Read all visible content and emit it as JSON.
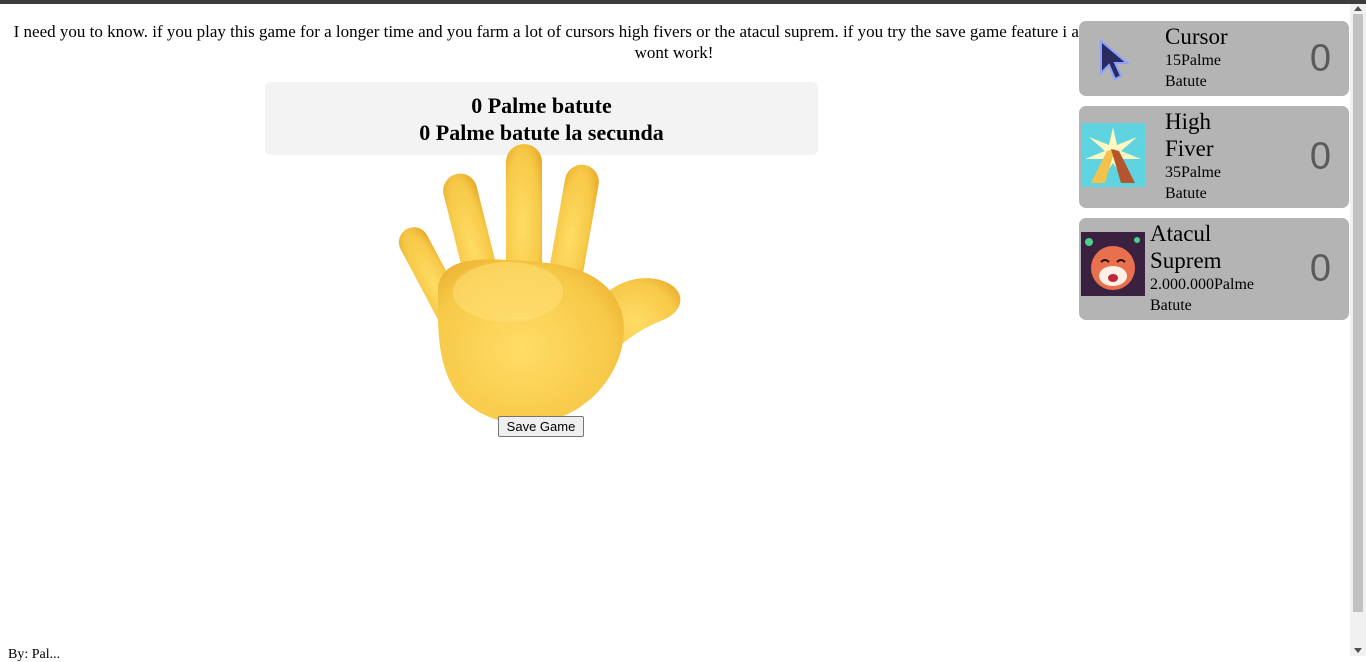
{
  "notice": {
    "text": "I need you to know. if you play this game for a longer time and you farm a lot of cursors high fivers or the atacul suprem. if you try the save game feature i am not responsable for this. the cookie wont work!"
  },
  "score": {
    "total_label": "0 Palme batute",
    "per_second_label": "0 Palme batute la secunda"
  },
  "hand": {
    "icon": "raised-hand-icon"
  },
  "save_button": {
    "label": "Save Game"
  },
  "shop": {
    "items": [
      {
        "name": "Cursor",
        "price_line": "15Palme",
        "price_unit": "Batute",
        "count": "0",
        "icon": "cursor-icon"
      },
      {
        "name_line1": "High",
        "name_line2": "Fiver",
        "price_line": "35Palme",
        "price_unit": "Batute",
        "count": "0",
        "icon": "high-five-image"
      },
      {
        "name_line1": "Atacul",
        "name_line2": "Suprem",
        "price_line": "2.000.000Palme",
        "price_unit": "Batute",
        "count": "0",
        "icon": "character-image"
      }
    ]
  },
  "footer": {
    "text": "By: Pal..."
  }
}
